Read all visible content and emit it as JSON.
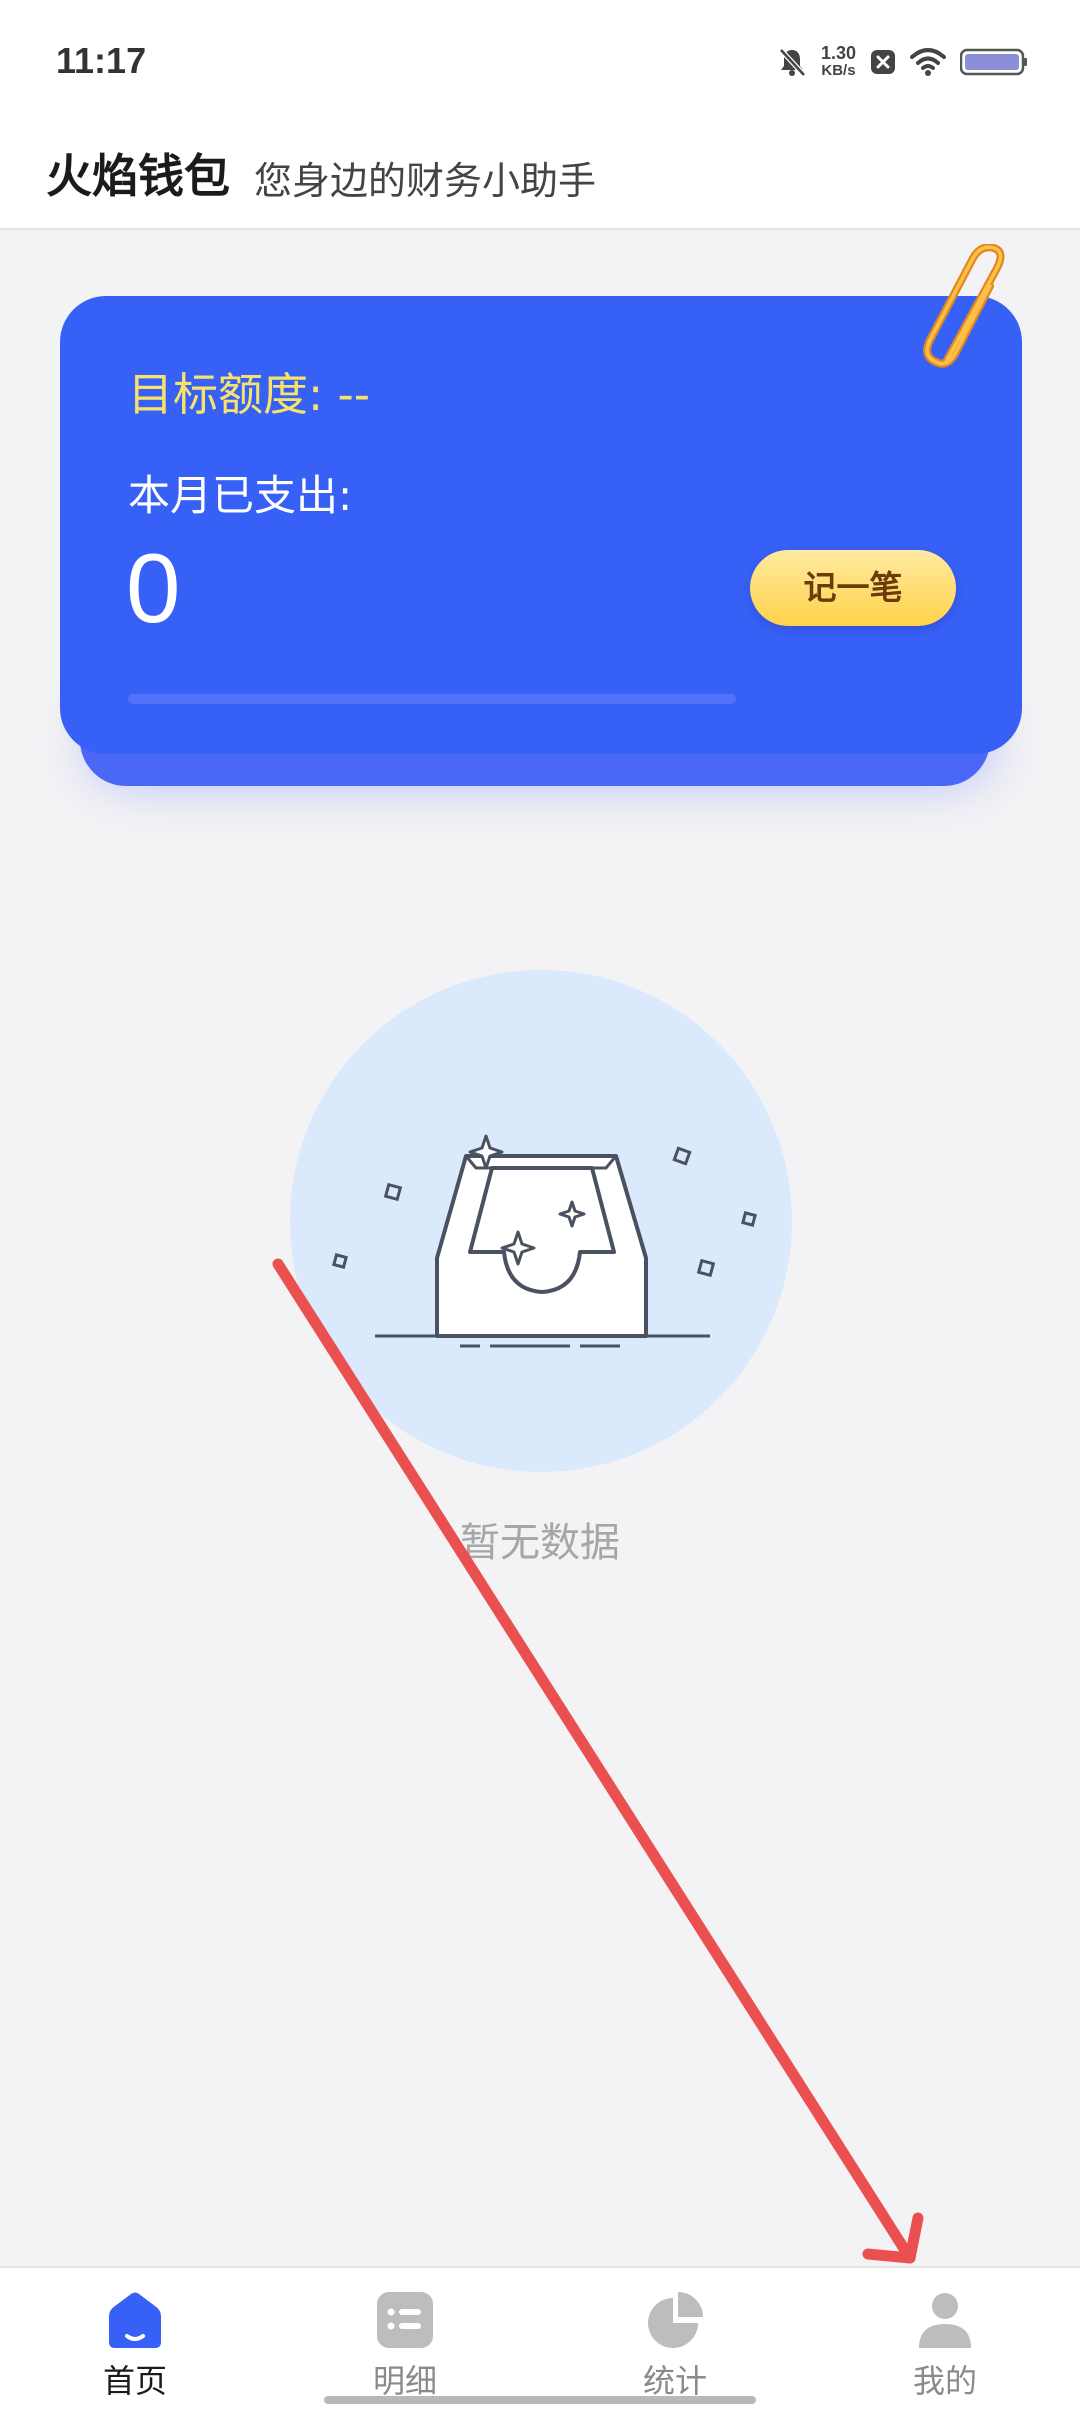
{
  "status_bar": {
    "time": "11:17",
    "net_speed_value": "1.30",
    "net_speed_unit": "KB/s",
    "icons": [
      "mute-bell-icon",
      "close-badge-icon",
      "wifi-icon",
      "battery-icon"
    ]
  },
  "header": {
    "title": "火焰钱包",
    "subtitle": "您身边的财务小助手"
  },
  "card": {
    "target_label": "目标额度: --",
    "spent_label": "本月已支出:",
    "spent_value": "0",
    "record_button": "记一笔",
    "progress_fraction": 0,
    "colors": {
      "card": "#3760f6",
      "target_text": "#f7e36a",
      "button": "#ffd24a"
    }
  },
  "empty_state": {
    "text": "暂无数据",
    "icon": "empty-inbox-icon"
  },
  "tabbar": {
    "tabs": [
      {
        "label": "首页",
        "icon": "home-icon",
        "active": true
      },
      {
        "label": "明细",
        "icon": "list-icon",
        "active": false
      },
      {
        "label": "统计",
        "icon": "pie-chart-icon",
        "active": false
      },
      {
        "label": "我的",
        "icon": "person-icon",
        "active": false
      }
    ],
    "active_color": "#3760f6",
    "inactive_color": "#bdbdbd"
  }
}
